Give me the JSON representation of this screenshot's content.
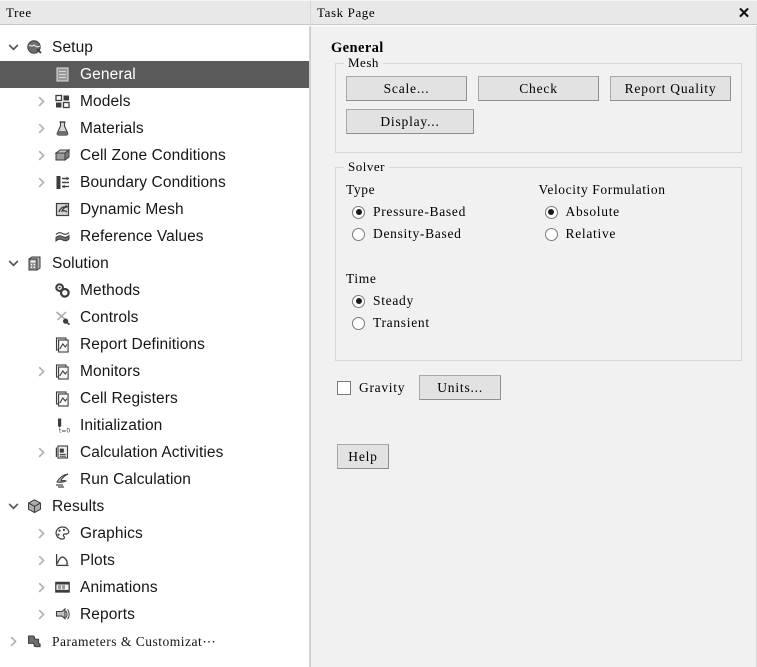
{
  "tree_panel": {
    "header_title": "Tree",
    "items": [
      {
        "label": "Setup",
        "indent": 0,
        "twisty": "down",
        "icon": "setup-icon",
        "selected": false,
        "font": "sans"
      },
      {
        "label": "General",
        "indent": 1,
        "twisty": "none",
        "icon": "general-icon",
        "selected": true,
        "font": "sans"
      },
      {
        "label": "Models",
        "indent": 1,
        "twisty": "right",
        "icon": "models-icon",
        "selected": false,
        "font": "sans"
      },
      {
        "label": "Materials",
        "indent": 1,
        "twisty": "right",
        "icon": "materials-flask-icon",
        "selected": false,
        "font": "sans"
      },
      {
        "label": "Cell Zone Conditions",
        "indent": 1,
        "twisty": "right",
        "icon": "cell-zone-box-icon",
        "selected": false,
        "font": "sans"
      },
      {
        "label": "Boundary Conditions",
        "indent": 1,
        "twisty": "right",
        "icon": "boundary-conditions-icon",
        "selected": false,
        "font": "sans"
      },
      {
        "label": "Dynamic Mesh",
        "indent": 1,
        "twisty": "none",
        "icon": "dynamic-mesh-icon",
        "selected": false,
        "font": "sans"
      },
      {
        "label": "Reference Values",
        "indent": 1,
        "twisty": "none",
        "icon": "reference-values-icon",
        "selected": false,
        "font": "sans"
      },
      {
        "label": "Solution",
        "indent": 0,
        "twisty": "down",
        "icon": "solution-icon",
        "selected": false,
        "font": "sans"
      },
      {
        "label": "Methods",
        "indent": 1,
        "twisty": "none",
        "icon": "methods-gears-icon",
        "selected": false,
        "font": "sans"
      },
      {
        "label": "Controls",
        "indent": 1,
        "twisty": "none",
        "icon": "controls-icon",
        "selected": false,
        "font": "sans"
      },
      {
        "label": "Report Definitions",
        "indent": 1,
        "twisty": "none",
        "icon": "report-definitions-icon",
        "selected": false,
        "font": "sans"
      },
      {
        "label": "Monitors",
        "indent": 1,
        "twisty": "right",
        "icon": "monitors-icon",
        "selected": false,
        "font": "sans"
      },
      {
        "label": "Cell Registers",
        "indent": 1,
        "twisty": "none",
        "icon": "cell-registers-icon",
        "selected": false,
        "font": "sans"
      },
      {
        "label": "Initialization",
        "indent": 1,
        "twisty": "none",
        "icon": "initialization-icon",
        "selected": false,
        "font": "sans"
      },
      {
        "label": "Calculation Activities",
        "indent": 1,
        "twisty": "right",
        "icon": "calculation-activities-icon",
        "selected": false,
        "font": "sans"
      },
      {
        "label": "Run Calculation",
        "indent": 1,
        "twisty": "none",
        "icon": "run-calculation-icon",
        "selected": false,
        "font": "sans"
      },
      {
        "label": "Results",
        "indent": 0,
        "twisty": "down",
        "icon": "results-cube-icon",
        "selected": false,
        "font": "sans"
      },
      {
        "label": "Graphics",
        "indent": 1,
        "twisty": "right",
        "icon": "graphics-palette-icon",
        "selected": false,
        "font": "sans"
      },
      {
        "label": "Plots",
        "indent": 1,
        "twisty": "right",
        "icon": "plots-icon",
        "selected": false,
        "font": "sans"
      },
      {
        "label": "Animations",
        "indent": 1,
        "twisty": "right",
        "icon": "animations-film-icon",
        "selected": false,
        "font": "sans"
      },
      {
        "label": "Reports",
        "indent": 1,
        "twisty": "right",
        "icon": "reports-icon",
        "selected": false,
        "font": "sans"
      },
      {
        "label": "Parameters & Customizat⋯",
        "indent": 0,
        "twisty": "right",
        "icon": "parameters-puzzle-icon",
        "selected": false,
        "font": "mono"
      }
    ]
  },
  "task_page": {
    "header_title": "Task Page",
    "close_label": "✕",
    "section_title": "General",
    "mesh": {
      "legend": "Mesh",
      "scale_label": "Scale...",
      "check_label": "Check",
      "report_quality_label": "Report Quality",
      "display_label": "Display..."
    },
    "solver": {
      "legend": "Solver",
      "type_label": "Type",
      "type_options": [
        {
          "label": "Pressure-Based",
          "selected": true
        },
        {
          "label": "Density-Based",
          "selected": false
        }
      ],
      "velocity_formulation_label": "Velocity Formulation",
      "velocity_options": [
        {
          "label": "Absolute",
          "selected": true
        },
        {
          "label": "Relative",
          "selected": false
        }
      ],
      "time_label": "Time",
      "time_options": [
        {
          "label": "Steady",
          "selected": true
        },
        {
          "label": "Transient",
          "selected": false
        }
      ]
    },
    "gravity": {
      "label": "Gravity",
      "checked": false,
      "units_label": "Units..."
    },
    "help_label": "Help"
  },
  "colors": {
    "selection_bg": "#5a5a5a",
    "selection_fg": "#ffffff",
    "panel_bg": "#f1f1f1",
    "header_bg": "#e8e8e8",
    "button_bg": "#e2e2e2",
    "tree_bg": "#ffffff",
    "border": "#d6d6d6"
  }
}
